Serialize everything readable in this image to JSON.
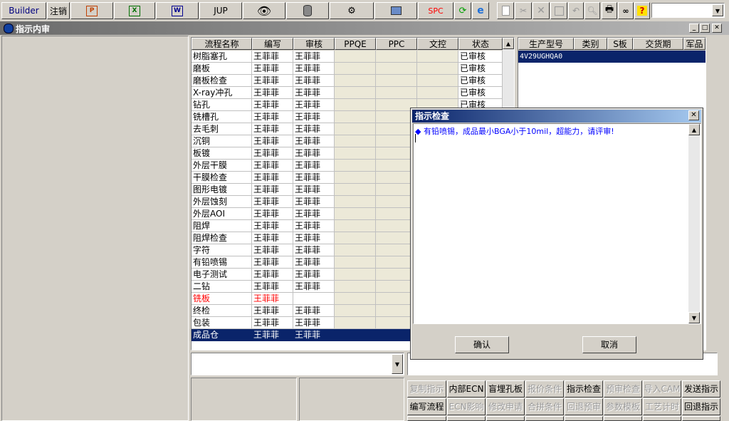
{
  "toolbar": {
    "builder": "Builder",
    "logout": "注销",
    "jup": "JUP",
    "spc": "SPC"
  },
  "window": {
    "title": "指示内审"
  },
  "flow_grid": {
    "headers": [
      "流程名称",
      "编写",
      "审核",
      "PPQE",
      "PPC",
      "文控",
      "状态"
    ],
    "rows": [
      {
        "name": "树脂塞孔",
        "writer": "王菲菲",
        "reviewer": "王菲菲",
        "status": "已审核"
      },
      {
        "name": "磨板",
        "writer": "王菲菲",
        "reviewer": "王菲菲",
        "status": "已审核"
      },
      {
        "name": "磨板检查",
        "writer": "王菲菲",
        "reviewer": "王菲菲",
        "status": "已审核"
      },
      {
        "name": "X-ray冲孔",
        "writer": "王菲菲",
        "reviewer": "王菲菲",
        "status": "已审核"
      },
      {
        "name": "钻孔",
        "writer": "王菲菲",
        "reviewer": "王菲菲",
        "status": "已审核"
      },
      {
        "name": "铣槽孔",
        "writer": "王菲菲",
        "reviewer": "王菲菲",
        "status": ""
      },
      {
        "name": "去毛刺",
        "writer": "王菲菲",
        "reviewer": "王菲菲",
        "status": ""
      },
      {
        "name": "沉铜",
        "writer": "王菲菲",
        "reviewer": "王菲菲",
        "status": ""
      },
      {
        "name": "板镀",
        "writer": "王菲菲",
        "reviewer": "王菲菲",
        "status": ""
      },
      {
        "name": "外层干膜",
        "writer": "王菲菲",
        "reviewer": "王菲菲",
        "status": ""
      },
      {
        "name": "干膜检查",
        "writer": "王菲菲",
        "reviewer": "王菲菲",
        "status": ""
      },
      {
        "name": "图形电镀",
        "writer": "王菲菲",
        "reviewer": "王菲菲",
        "status": ""
      },
      {
        "name": "外层蚀刻",
        "writer": "王菲菲",
        "reviewer": "王菲菲",
        "status": ""
      },
      {
        "name": "外层AOI",
        "writer": "王菲菲",
        "reviewer": "王菲菲",
        "status": ""
      },
      {
        "name": "阻焊",
        "writer": "王菲菲",
        "reviewer": "王菲菲",
        "status": ""
      },
      {
        "name": "阻焊检查",
        "writer": "王菲菲",
        "reviewer": "王菲菲",
        "status": ""
      },
      {
        "name": "字符",
        "writer": "王菲菲",
        "reviewer": "王菲菲",
        "status": ""
      },
      {
        "name": "有铅喷锡",
        "writer": "王菲菲",
        "reviewer": "王菲菲",
        "status": ""
      },
      {
        "name": "电子测试",
        "writer": "王菲菲",
        "reviewer": "王菲菲",
        "status": ""
      },
      {
        "name": "二钻",
        "writer": "王菲菲",
        "reviewer": "王菲菲",
        "status": ""
      },
      {
        "name": "铣板",
        "writer": "王菲菲",
        "reviewer": "",
        "status": "",
        "red": true
      },
      {
        "name": "终检",
        "writer": "王菲菲",
        "reviewer": "王菲菲",
        "status": ""
      },
      {
        "name": "包装",
        "writer": "王菲菲",
        "reviewer": "王菲菲",
        "status": ""
      },
      {
        "name": "成品仓",
        "writer": "王菲菲",
        "reviewer": "王菲菲",
        "status": "",
        "selected": true
      }
    ]
  },
  "product_grid": {
    "headers": [
      "生产型号",
      "类别",
      "S板",
      "交货期",
      "军品"
    ],
    "rows": [
      {
        "model": "4V29UGHQA0"
      }
    ]
  },
  "dialog": {
    "title": "指示检查",
    "message": "有铅喷锡，成品最小BGA小于10mil，超能力，请评审!",
    "ok": "确认",
    "cancel": "取消"
  },
  "buttons_row1": [
    {
      "label": "复制指示",
      "enabled": false
    },
    {
      "label": "内部ECN",
      "enabled": true
    },
    {
      "label": "盲埋孔板",
      "enabled": true
    },
    {
      "label": "报价条件",
      "enabled": false
    },
    {
      "label": "指示检查",
      "enabled": true
    },
    {
      "label": "预审检查",
      "enabled": false
    },
    {
      "label": "导入CAM",
      "enabled": false
    },
    {
      "label": "发送指示",
      "enabled": true
    }
  ],
  "buttons_row2": [
    {
      "label": "编写流程",
      "enabled": true
    },
    {
      "label": "ECN影响",
      "enabled": false
    },
    {
      "label": "修改申请",
      "enabled": false
    },
    {
      "label": "合拼条件",
      "enabled": false
    },
    {
      "label": "回退预审",
      "enabled": false
    },
    {
      "label": "参数模板",
      "enabled": false
    },
    {
      "label": "工艺计时",
      "enabled": false
    },
    {
      "label": "回退指示",
      "enabled": true
    }
  ]
}
